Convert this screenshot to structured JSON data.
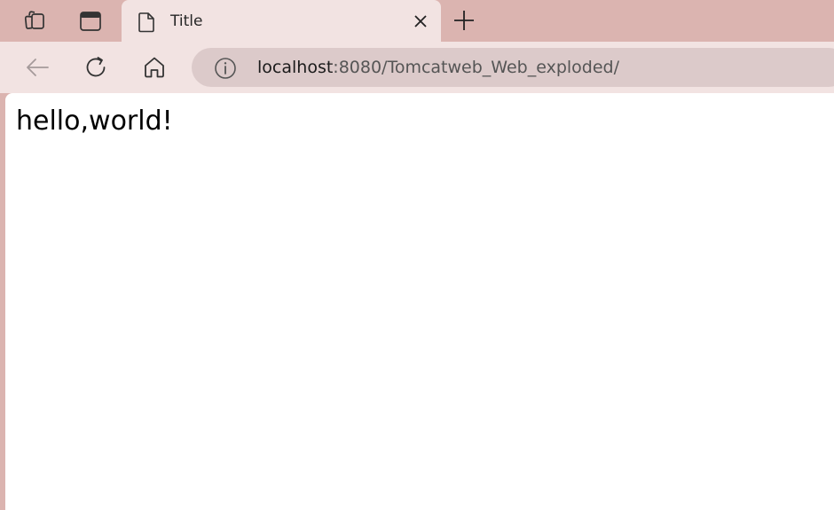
{
  "browser": {
    "tab": {
      "title": "Title"
    },
    "address": {
      "host": "localhost",
      "rest": ":8080/Tomcatweb_Web_exploded/"
    },
    "icons": {
      "workspaces": "workspaces-icon",
      "tab_actions": "tab-actions-icon",
      "page": "page-icon",
      "close": "close-icon",
      "new_tab": "plus-icon",
      "back": "back-arrow-icon",
      "refresh": "refresh-icon",
      "home": "home-icon",
      "info": "info-icon"
    },
    "colors": {
      "tabstrip": "#dbb4b0",
      "toolbar": "#f2e3e2",
      "addressbar": "#dccaca"
    }
  },
  "page": {
    "text": "hello,world!"
  }
}
